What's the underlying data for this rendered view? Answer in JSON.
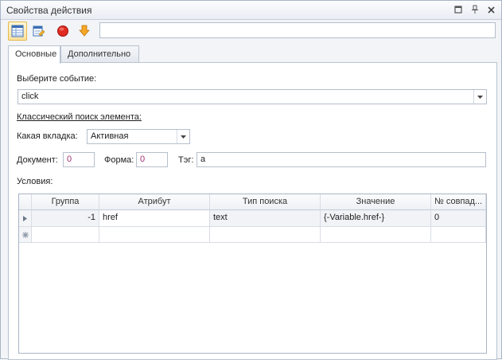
{
  "window": {
    "title": "Свойства действия"
  },
  "toolbar": {
    "address_value": ""
  },
  "tabs": [
    {
      "label": "Основные"
    },
    {
      "label": "Дополнительно"
    }
  ],
  "form": {
    "event_label": "Выберите событие:",
    "event_value": "click",
    "section_title": "Классический поиск элемента:",
    "tab_label": "Какая вкладка:",
    "tab_value": "Активная",
    "document_label": "Документ:",
    "document_value": "0",
    "form_label": "Форма:",
    "form_value": "0",
    "tag_label": "Тэг:",
    "tag_value": "a",
    "conditions_label": "Условия:"
  },
  "grid": {
    "columns": [
      "Группа",
      "Атрибут",
      "Тип поиска",
      "Значение",
      "№ совпад..."
    ],
    "rows": [
      [
        "-1",
        "href",
        "text",
        "{-Variable.href-}",
        "0"
      ]
    ]
  }
}
